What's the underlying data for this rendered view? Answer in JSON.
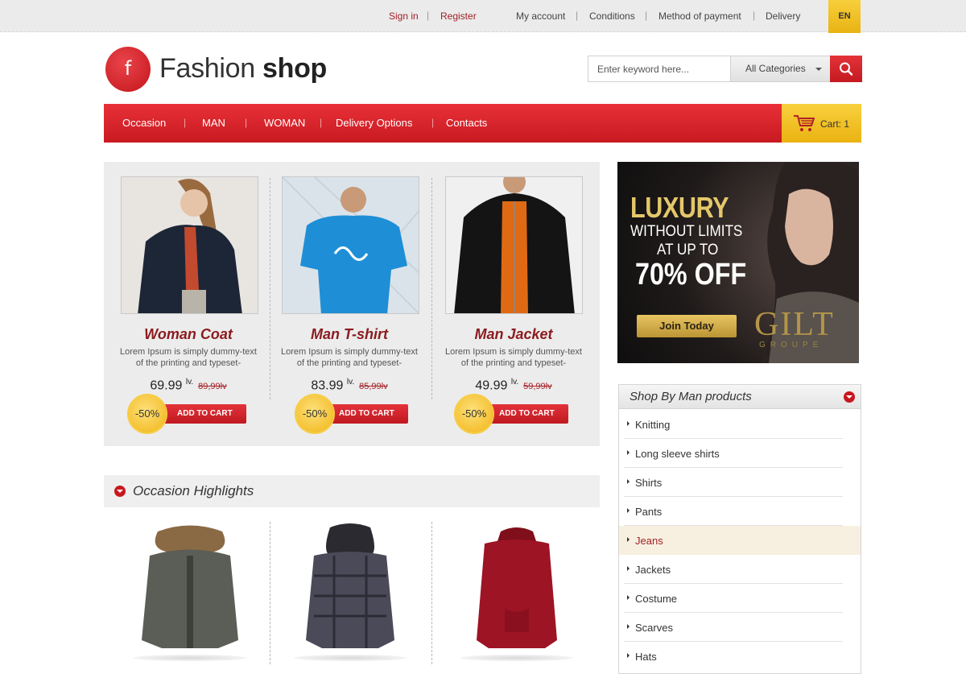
{
  "topbar": {
    "sign_in": "Sign in",
    "register": "Register",
    "links": [
      "My account",
      "Conditions",
      "Method of payment",
      "Delivery"
    ],
    "lang": "EN",
    "separator": "|"
  },
  "logo": {
    "letter": "f",
    "word1": "Fashion",
    "word2": "shop"
  },
  "search": {
    "placeholder": "Enter keyword here...",
    "category": "All Categories"
  },
  "nav": {
    "items": [
      "Occasion",
      "MAN",
      "WOMAN",
      "Delivery Options",
      "Contacts"
    ],
    "separator": "|"
  },
  "cart": {
    "label": "Cart: 1"
  },
  "featured": [
    {
      "name": "Woman Coat",
      "desc": "Lorem Ipsum is simply dummy-text of the printing and typeset-",
      "price": "69.99",
      "unit": "lv.",
      "old": "89,99lv",
      "discount": "-50%",
      "add": "ADD TO CART"
    },
    {
      "name": "Man T-shirt",
      "desc": "Lorem Ipsum is simply dummy-text of the printing and typeset-",
      "price": "83.99",
      "unit": "lv.",
      "old": "85,99lv",
      "discount": "-50%",
      "add": "ADD TO CART"
    },
    {
      "name": "Man Jacket",
      "desc": "Lorem Ipsum is simply dummy-text of the printing and typeset-",
      "price": "49.99",
      "unit": "lv.",
      "old": "59,99lv",
      "discount": "-50%",
      "add": "ADD TO CART"
    }
  ],
  "banner": {
    "line1": "LUXURY",
    "line2": "WITHOUT LIMITS",
    "line3": "AT UP TO",
    "line4": "70% OFF",
    "button": "Join Today",
    "brand": "GILT",
    "brand_sub": "GROUPE"
  },
  "shop_by": {
    "title": "Shop By Man products",
    "items": [
      "Knitting",
      "Long sleeve shirts",
      "Shirts",
      "Pants",
      "Jeans",
      "Jackets",
      "Costume",
      "Scarves",
      "Hats"
    ],
    "active_index": 4
  },
  "occasion": {
    "title": "Occasion Highlights"
  },
  "colors": {
    "accent": "#d0222a",
    "gold": "#f0bd1d",
    "title_red": "#8b1b1f"
  }
}
